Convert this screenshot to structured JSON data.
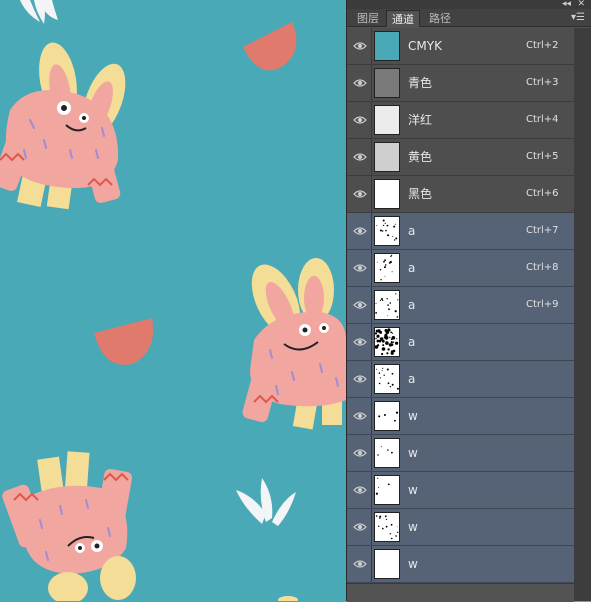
{
  "canvas": {
    "background": "#4aa9b7",
    "illustration": "pattern-monsters-leaves-bowls"
  },
  "panel": {
    "tabs": [
      {
        "label": "图层",
        "active": false
      },
      {
        "label": "通道",
        "active": true
      },
      {
        "label": "路径",
        "active": false
      }
    ],
    "collapse_icon": "double-chevron-icon",
    "close_icon": "close-icon",
    "menu_icon": "panel-menu-icon",
    "channels": [
      {
        "name": "CMYK",
        "shortcut": "Ctrl+2",
        "thumb": "cmyk",
        "row": "gray"
      },
      {
        "name": "青色",
        "shortcut": "Ctrl+3",
        "thumb": "cyan",
        "row": "gray"
      },
      {
        "name": "洋红",
        "shortcut": "Ctrl+4",
        "thumb": "magenta",
        "row": "gray"
      },
      {
        "name": "黄色",
        "shortcut": "Ctrl+5",
        "thumb": "yellow",
        "row": "gray"
      },
      {
        "name": "黑色",
        "shortcut": "Ctrl+6",
        "thumb": "black",
        "row": "gray"
      },
      {
        "name": "a",
        "shortcut": "Ctrl+7",
        "thumb": "speckle",
        "row": "blue"
      },
      {
        "name": "a",
        "shortcut": "Ctrl+8",
        "thumb": "speckle",
        "row": "blue"
      },
      {
        "name": "a",
        "shortcut": "Ctrl+9",
        "thumb": "speckle",
        "row": "blue"
      },
      {
        "name": "a",
        "shortcut": "",
        "thumb": "dense",
        "row": "blue"
      },
      {
        "name": "a",
        "shortcut": "",
        "thumb": "speckle",
        "row": "blue"
      },
      {
        "name": "w",
        "shortcut": "",
        "thumb": "sparse",
        "row": "blue"
      },
      {
        "name": "w",
        "shortcut": "",
        "thumb": "sparse",
        "row": "blue"
      },
      {
        "name": "w",
        "shortcut": "",
        "thumb": "sparse",
        "row": "blue"
      },
      {
        "name": "w",
        "shortcut": "",
        "thumb": "speckle",
        "row": "blue"
      },
      {
        "name": "w",
        "shortcut": "",
        "thumb": "blank",
        "row": "blue"
      }
    ]
  }
}
